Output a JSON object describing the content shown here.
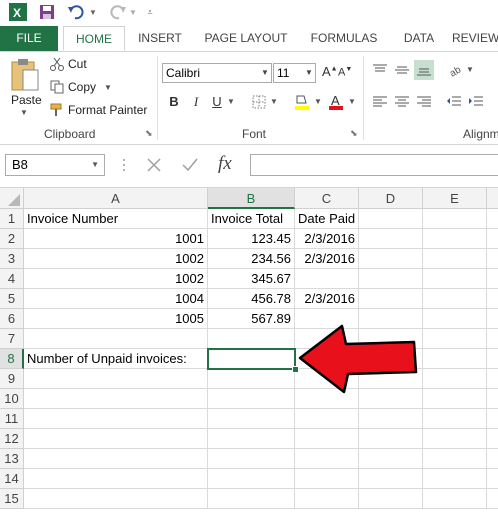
{
  "qat": {
    "app_icon": "excel-icon",
    "save_icon": "save-icon",
    "undo_icon": "undo-icon",
    "redo_icon": "redo-icon",
    "customize_icon": "customize-icon"
  },
  "tabs": [
    {
      "label": "FILE"
    },
    {
      "label": "HOME"
    },
    {
      "label": "INSERT"
    },
    {
      "label": "PAGE LAYOUT"
    },
    {
      "label": "FORMULAS"
    },
    {
      "label": "DATA"
    },
    {
      "label": "REVIEW"
    }
  ],
  "ribbon": {
    "clipboard": {
      "paste": "Paste",
      "cut": "Cut",
      "copy": "Copy",
      "format_painter": "Format Painter",
      "label": "Clipboard"
    },
    "font": {
      "name": "Calibri",
      "size": "11",
      "bold": "B",
      "italic": "I",
      "underline": "U",
      "label": "Font"
    },
    "alignment": {
      "label": "Alignm"
    }
  },
  "formula_bar": {
    "name_box": "B8",
    "fx": "fx",
    "value": ""
  },
  "columns": [
    "A",
    "B",
    "C",
    "D",
    "E"
  ],
  "rows": [
    "1",
    "2",
    "3",
    "4",
    "5",
    "6",
    "7",
    "8",
    "9",
    "10",
    "11",
    "12",
    "13",
    "14",
    "15"
  ],
  "cells": {
    "A1": "Invoice Number",
    "B1": "Invoice Total",
    "C1": "Date Paid",
    "A2": "1001",
    "B2": "123.45",
    "C2": "2/3/2016",
    "A3": "1002",
    "B3": "234.56",
    "C3": "2/3/2016",
    "A4": "1002",
    "B4": "345.67",
    "A5": "1004",
    "B5": "456.78",
    "C5": "2/3/2016",
    "A6": "1005",
    "B6": "567.89",
    "A8": "Number of Unpaid invoices:"
  },
  "selected_cell": "B8",
  "colors": {
    "accent": "#217346",
    "arrow": "#e8101a"
  }
}
